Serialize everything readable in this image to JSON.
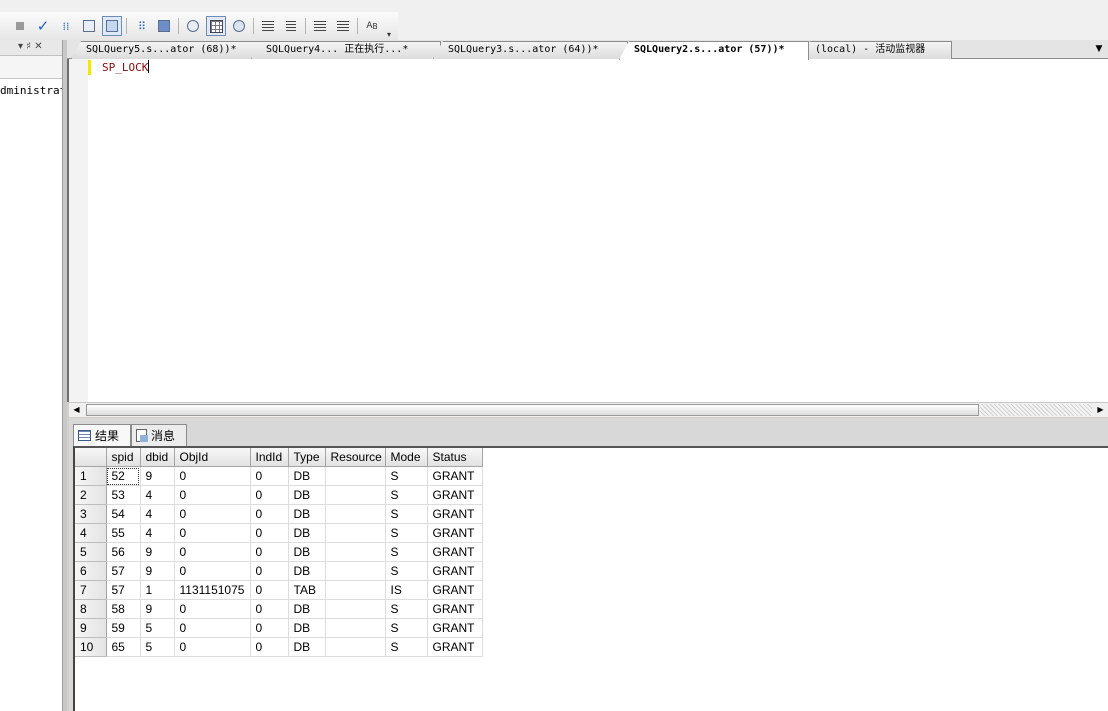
{
  "toolbar": {
    "icons": [
      "stop-icon",
      "check-icon",
      "debug-icon",
      "plan-icon",
      "options-icon",
      "estimated-plan-icon",
      "query-design-icon",
      "results-text-icon",
      "results-grid-icon",
      "results-file-icon",
      "comment-icon",
      "uncomment-icon",
      "decrease-indent-icon",
      "increase-indent-icon",
      "spec-values-icon"
    ]
  },
  "left_panel": {
    "controls": "▾ ♯ ✕",
    "tree_item": "dministrato"
  },
  "tabs": [
    {
      "label": "SQLQuery5.s...ator (68))*",
      "active": false
    },
    {
      "label": "SQLQuery4... 正在执行...*",
      "active": false
    },
    {
      "label": "SQLQuery3.s...ator (64))*",
      "active": false
    },
    {
      "label": "SQLQuery2.s...ator (57))*",
      "active": true
    },
    {
      "label": "(local) - 活动监视器",
      "active": false
    }
  ],
  "tab_overflow": "▼",
  "editor": {
    "code": "SP_LOCK"
  },
  "results": {
    "tabs": [
      {
        "label": "结果",
        "active": true
      },
      {
        "label": "消息",
        "active": false
      }
    ],
    "columns": [
      "",
      "spid",
      "dbid",
      "ObjId",
      "IndId",
      "Type",
      "Resource",
      "Mode",
      "Status"
    ],
    "rows": [
      [
        "1",
        "52",
        "9",
        "0",
        "0",
        "DB",
        "",
        "S",
        "GRANT"
      ],
      [
        "2",
        "53",
        "4",
        "0",
        "0",
        "DB",
        "",
        "S",
        "GRANT"
      ],
      [
        "3",
        "54",
        "4",
        "0",
        "0",
        "DB",
        "",
        "S",
        "GRANT"
      ],
      [
        "4",
        "55",
        "4",
        "0",
        "0",
        "DB",
        "",
        "S",
        "GRANT"
      ],
      [
        "5",
        "56",
        "9",
        "0",
        "0",
        "DB",
        "",
        "S",
        "GRANT"
      ],
      [
        "6",
        "57",
        "9",
        "0",
        "0",
        "DB",
        "",
        "S",
        "GRANT"
      ],
      [
        "7",
        "57",
        "1",
        "1131151075",
        "0",
        "TAB",
        "",
        "IS",
        "GRANT"
      ],
      [
        "8",
        "58",
        "9",
        "0",
        "0",
        "DB",
        "",
        "S",
        "GRANT"
      ],
      [
        "9",
        "59",
        "5",
        "0",
        "0",
        "DB",
        "",
        "S",
        "GRANT"
      ],
      [
        "10",
        "65",
        "5",
        "0",
        "0",
        "DB",
        "",
        "S",
        "GRANT"
      ]
    ]
  }
}
